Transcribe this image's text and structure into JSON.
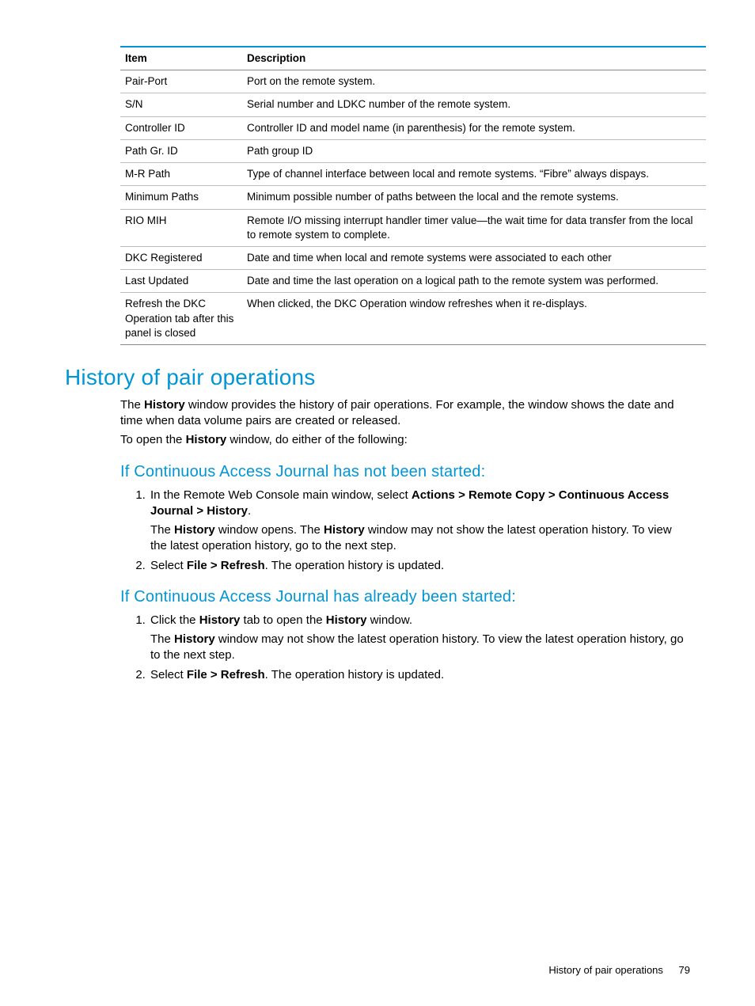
{
  "table": {
    "headers": {
      "item": "Item",
      "description": "Description"
    },
    "rows": [
      {
        "item": "Pair-Port",
        "desc": "Port on the remote system."
      },
      {
        "item": "S/N",
        "desc": "Serial number and LDKC number of the remote system."
      },
      {
        "item": "Controller ID",
        "desc": "Controller ID and model name (in parenthesis) for the remote system."
      },
      {
        "item": "Path Gr. ID",
        "desc": "Path group ID"
      },
      {
        "item": "M-R Path",
        "desc": "Type of channel interface between local and remote systems. “Fibre” always dispays."
      },
      {
        "item": "Minimum Paths",
        "desc": "Minimum possible number of paths between the local and the remote systems."
      },
      {
        "item": "RIO MIH",
        "desc": "Remote I/O missing interrupt handler timer value—the wait time for data transfer from the local to remote system to complete."
      },
      {
        "item": "DKC Registered",
        "desc": "Date and time when local and remote systems were associated to each other"
      },
      {
        "item": "Last Updated",
        "desc": "Date and time the last operation on a logical path to the remote system was performed."
      },
      {
        "item": "Refresh the DKC Operation tab after this panel is closed",
        "desc": "When clicked, the DKC Operation window refreshes when it re-displays."
      }
    ]
  },
  "section_title": "History of pair operations",
  "intro": {
    "p1_a": "The ",
    "p1_b": "History",
    "p1_c": " window provides the history of pair operations. For example, the window shows the date and time when data volume pairs are created or released.",
    "p2_a": "To open the ",
    "p2_b": "History",
    "p2_c": " window, do either of the following:"
  },
  "sub1": {
    "title": "If Continuous Access Journal has not been started:",
    "step1": {
      "a": "In the Remote Web Console main window, select ",
      "b": "Actions > Remote Copy > Continuous Access Journal > History",
      "c": ".",
      "p2_a": "The ",
      "p2_b": "History",
      "p2_c": " window opens. The ",
      "p2_d": "History",
      "p2_e": " window may not show the latest operation history. To view the latest operation history, go to the next step."
    },
    "step2": {
      "a": "Select ",
      "b": "File > Refresh",
      "c": ". The operation history is updated."
    }
  },
  "sub2": {
    "title": "If Continuous Access Journal has already been started:",
    "step1": {
      "a": "Click the ",
      "b": "History",
      "c": " tab to open the ",
      "d": "History",
      "e": " window.",
      "p2_a": "The ",
      "p2_b": "History",
      "p2_c": " window may not show the latest operation history. To view the latest operation history, go to the next step."
    },
    "step2": {
      "a": "Select ",
      "b": "File > Refresh",
      "c": ". The operation history is updated."
    }
  },
  "footer": {
    "title": "History of pair operations",
    "page": "79"
  }
}
